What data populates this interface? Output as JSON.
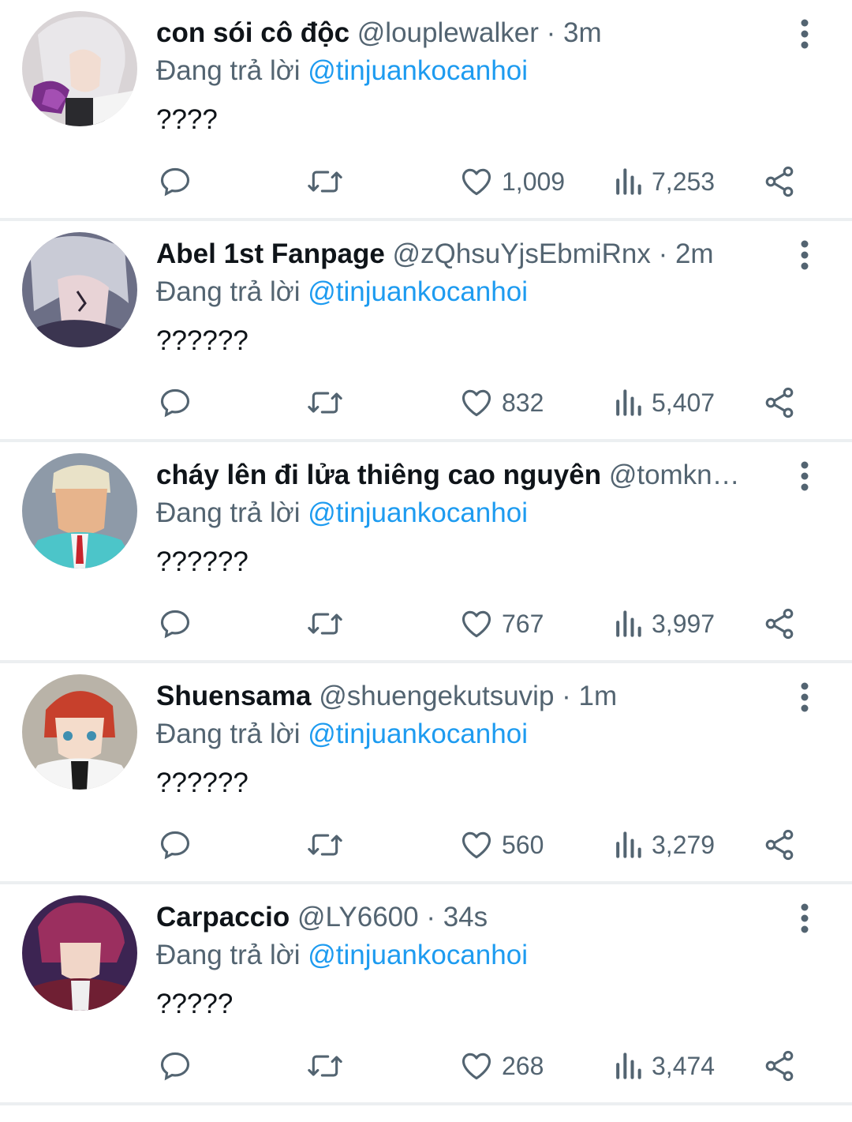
{
  "reply_prefix": "Đang trả lời",
  "colors": {
    "link": "#1d9bf0",
    "muted": "#536471",
    "text": "#0f1419"
  },
  "icons": {
    "reply": "reply-icon",
    "retweet": "retweet-icon",
    "like": "heart-icon",
    "views": "views-icon",
    "share": "share-icon",
    "more": "more-vertical-icon"
  },
  "tweets": [
    {
      "name": "con sói cô độc",
      "handle": "@louplewalker",
      "dot": "·",
      "time": "3m",
      "reply_to": "@tinjuankocanhoi",
      "text": "????",
      "likes": "1,009",
      "views": "7,253"
    },
    {
      "name": "Abel 1st Fanpage",
      "handle": "@zQhsuYjsEbmiRnx",
      "dot": "·",
      "time": "2m",
      "reply_to": "@tinjuankocanhoi",
      "text": "??????",
      "likes": "832",
      "views": "5,407"
    },
    {
      "name": "cháy lên đi lửa thiêng cao nguyên",
      "handle": "@tomkn…",
      "dot": "",
      "time": "",
      "reply_to": "@tinjuankocanhoi",
      "text": "??????",
      "likes": "767",
      "views": "3,997"
    },
    {
      "name": "Shuensama",
      "handle": "@shuengekutsuvip",
      "dot": "·",
      "time": "1m",
      "reply_to": "@tinjuankocanhoi",
      "text": "??????",
      "likes": "560",
      "views": "3,279"
    },
    {
      "name": "Carpaccio",
      "handle": "@LY6600",
      "dot": "·",
      "time": "34s",
      "reply_to": "@tinjuankocanhoi",
      "text": "?????",
      "likes": "268",
      "views": "3,474"
    }
  ]
}
